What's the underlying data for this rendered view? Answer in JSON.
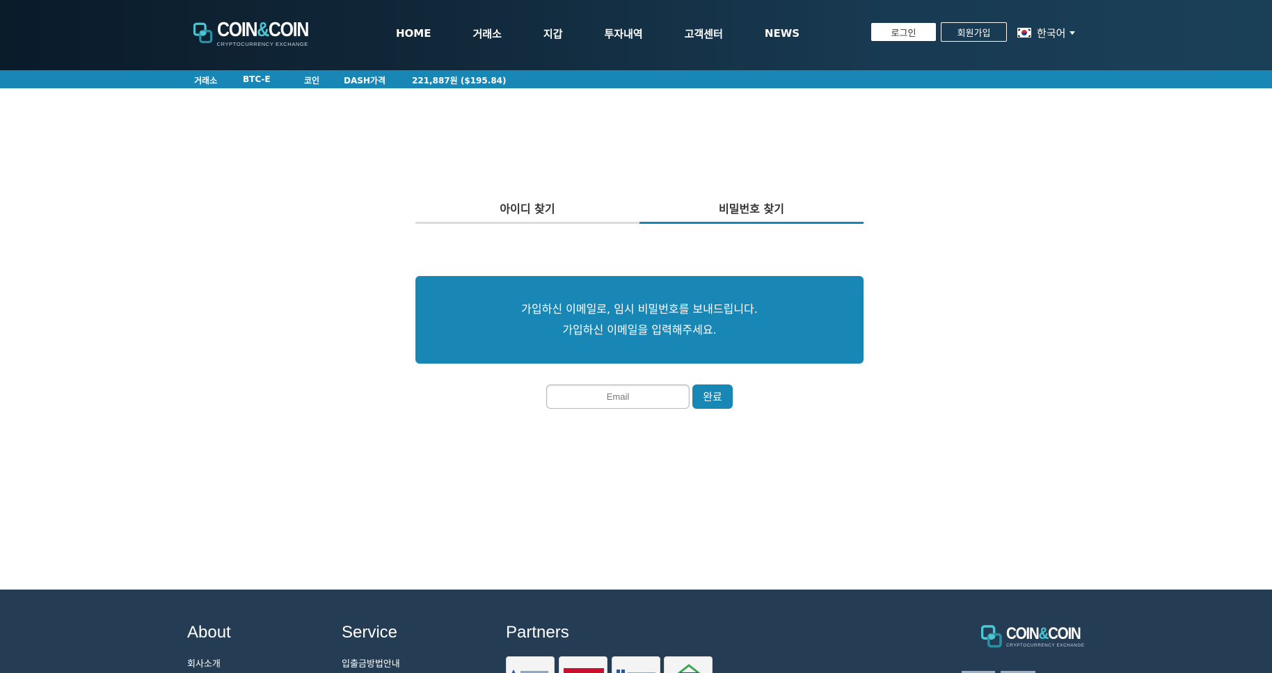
{
  "header": {
    "logo": {
      "name_left": "COIN",
      "name_amp": "&",
      "name_right": "COIN",
      "tagline": "CRYPTOCURRENCY EXCHANGE"
    },
    "nav": [
      "HOME",
      "거래소",
      "지갑",
      "투자내역",
      "고객센터",
      "NEWS"
    ],
    "login_label": "로그인",
    "signup_label": "회원가입",
    "language": "한국어"
  },
  "ticker": {
    "exchange_label": "거래소",
    "exchange_value": "BTC-E",
    "coin_label": "코인",
    "price_label": "DASH가격",
    "price_value": "221,887원 ($195.84)"
  },
  "tabs": [
    {
      "label": "아이디 찾기",
      "active": false
    },
    {
      "label": "비밀번호 찾기",
      "active": true
    }
  ],
  "info": {
    "line1": "가입하신 이메일로, 임시 비밀번호를 보내드립니다.",
    "line2": "가입하신 이메일을 입력해주세요."
  },
  "form": {
    "email_placeholder": "Email",
    "email_value": "",
    "submit_label": "완료"
  },
  "footer": {
    "about_heading": "About",
    "about_link": "회사소개",
    "service_heading": "Service",
    "service_link": "입출금방법안내",
    "partners_heading": "Partners"
  },
  "colors": {
    "header_dark": "#0a1b2a",
    "accent": "#1987b5",
    "footer_bg": "#243d55",
    "logo_teal": "#4bc6d3"
  }
}
